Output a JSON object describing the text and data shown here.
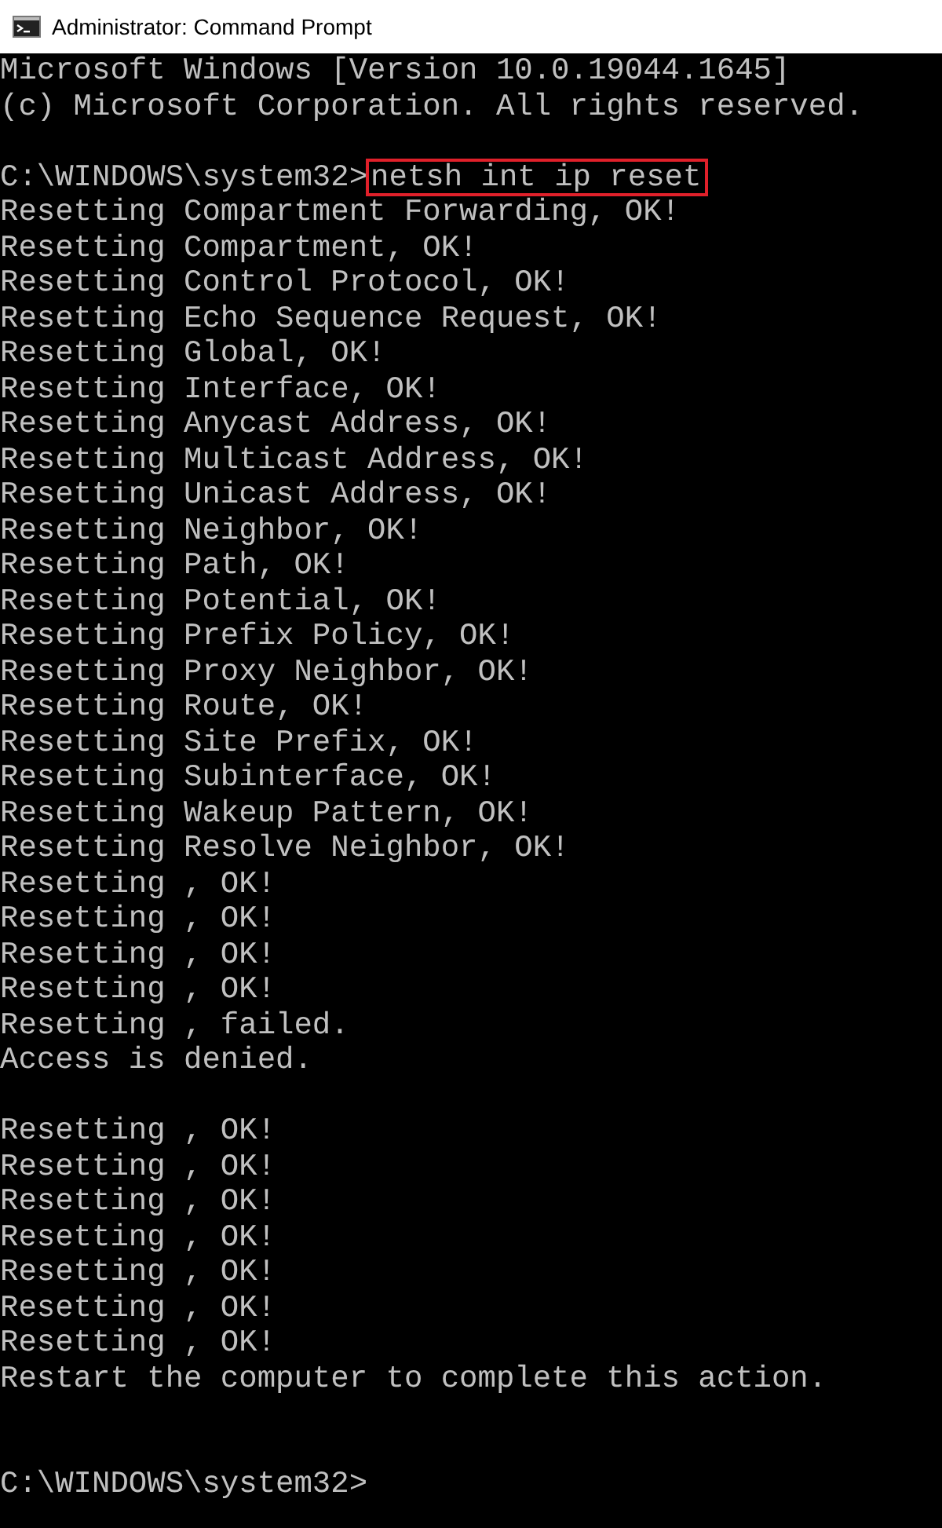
{
  "window": {
    "title": "Administrator: Command Prompt"
  },
  "console": {
    "lines": [
      {
        "kind": "output",
        "text": "Microsoft Windows [Version 10.0.19044.1645]"
      },
      {
        "kind": "output",
        "text": "(c) Microsoft Corporation. All rights reserved."
      },
      {
        "kind": "blank"
      },
      {
        "kind": "command",
        "prompt": "C:\\WINDOWS\\system32>",
        "command": "netsh int ip reset",
        "highlighted": true
      },
      {
        "kind": "output",
        "text": "Resetting Compartment Forwarding, OK!"
      },
      {
        "kind": "output",
        "text": "Resetting Compartment, OK!"
      },
      {
        "kind": "output",
        "text": "Resetting Control Protocol, OK!"
      },
      {
        "kind": "output",
        "text": "Resetting Echo Sequence Request, OK!"
      },
      {
        "kind": "output",
        "text": "Resetting Global, OK!"
      },
      {
        "kind": "output",
        "text": "Resetting Interface, OK!"
      },
      {
        "kind": "output",
        "text": "Resetting Anycast Address, OK!"
      },
      {
        "kind": "output",
        "text": "Resetting Multicast Address, OK!"
      },
      {
        "kind": "output",
        "text": "Resetting Unicast Address, OK!"
      },
      {
        "kind": "output",
        "text": "Resetting Neighbor, OK!"
      },
      {
        "kind": "output",
        "text": "Resetting Path, OK!"
      },
      {
        "kind": "output",
        "text": "Resetting Potential, OK!"
      },
      {
        "kind": "output",
        "text": "Resetting Prefix Policy, OK!"
      },
      {
        "kind": "output",
        "text": "Resetting Proxy Neighbor, OK!"
      },
      {
        "kind": "output",
        "text": "Resetting Route, OK!"
      },
      {
        "kind": "output",
        "text": "Resetting Site Prefix, OK!"
      },
      {
        "kind": "output",
        "text": "Resetting Subinterface, OK!"
      },
      {
        "kind": "output",
        "text": "Resetting Wakeup Pattern, OK!"
      },
      {
        "kind": "output",
        "text": "Resetting Resolve Neighbor, OK!"
      },
      {
        "kind": "output",
        "text": "Resetting , OK!"
      },
      {
        "kind": "output",
        "text": "Resetting , OK!"
      },
      {
        "kind": "output",
        "text": "Resetting , OK!"
      },
      {
        "kind": "output",
        "text": "Resetting , OK!"
      },
      {
        "kind": "output",
        "text": "Resetting , failed."
      },
      {
        "kind": "output",
        "text": "Access is denied."
      },
      {
        "kind": "blank"
      },
      {
        "kind": "output",
        "text": "Resetting , OK!"
      },
      {
        "kind": "output",
        "text": "Resetting , OK!"
      },
      {
        "kind": "output",
        "text": "Resetting , OK!"
      },
      {
        "kind": "output",
        "text": "Resetting , OK!"
      },
      {
        "kind": "output",
        "text": "Resetting , OK!"
      },
      {
        "kind": "output",
        "text": "Resetting , OK!"
      },
      {
        "kind": "output",
        "text": "Resetting , OK!"
      },
      {
        "kind": "output",
        "text": "Restart the computer to complete this action."
      },
      {
        "kind": "blank"
      },
      {
        "kind": "blank"
      },
      {
        "kind": "command",
        "prompt": "C:\\WINDOWS\\system32>"
      }
    ]
  }
}
